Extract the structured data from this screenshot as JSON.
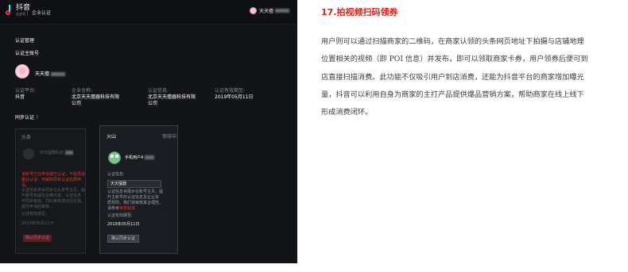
{
  "screenshot": {
    "logo": {
      "name": "抖音",
      "sub": "企业号"
    },
    "nav_item": "企业认证",
    "user_name": "天天擅",
    "section_title": "认证管理",
    "main_account_label": "认证主账号",
    "account_name": "天天擅",
    "info": {
      "platform_label": "认证平台:",
      "platform_value": "抖音",
      "company_label": "企业全称:",
      "company_value_1": "北京天天擅器科技有限",
      "company_value_2": "公司",
      "qual_label": "认证信息:",
      "qual_value_1": "北京天天擅器科技有限",
      "qual_value_2": "公司",
      "expiry_label": "认证有效期至:",
      "expiry_value": "2019年05月11日"
    },
    "sync_label": "同步认证",
    "left_card": {
      "title": "头条",
      "account": "天天擅器科技",
      "warning_1": "该账号已在申请或已认证，不能再进行",
      "warning_2": "企业认证，可解除原有认证后再申请。",
      "desc_1": "认证信息将会同步在头条号主页，提",
      "desc_2": "升账号权威性及曝光率，认证信息",
      "desc_3": "可同步修改，同时审核通过后生效。",
      "desc_4": "提交申请后审核...",
      "desc_5": "认证有效期至:",
      "date": "2019年05月11日",
      "button": "确认同步认证"
    },
    "right_card": {
      "title": "火山",
      "status": "审核中",
      "account": "手机用户4",
      "info_label": "认证信息:",
      "input_value": "天天擅器",
      "desc_1": "认证信息将展示在账号主页，提",
      "desc_2": "升主账号的认证信息及企业资",
      "desc_3": "质规则，我们将审核其合理性。",
      "desc_4_pre": "请参考",
      "desc_4_link": "审核标准",
      "desc_5": "认证有效期至:",
      "date": "2019年05月11日",
      "button": "确认同步认证"
    }
  },
  "article": {
    "title": "17.拍视频扫码领券",
    "lines": [
      "用户则可以通过扫描商家的二维码，在商家认领的头条网页地址下拍摄与店铺地理",
      "位置相关的视频（即 POI 信息）并发布，即可以领取商家卡券，用户领券后便可到",
      "店直接扫描消费。此功能不仅吸引用户到店消费，还能为抖音平台的商家增加曝光",
      "量，抖音可以利用自身为商家的主打产品提供爆品营销方案，帮助商家在线上线下",
      "形成消费闭环。"
    ]
  },
  "colors": {
    "accent_red": "#d9231a",
    "screen_bg": "#121418",
    "warning_red": "#e2352f"
  }
}
